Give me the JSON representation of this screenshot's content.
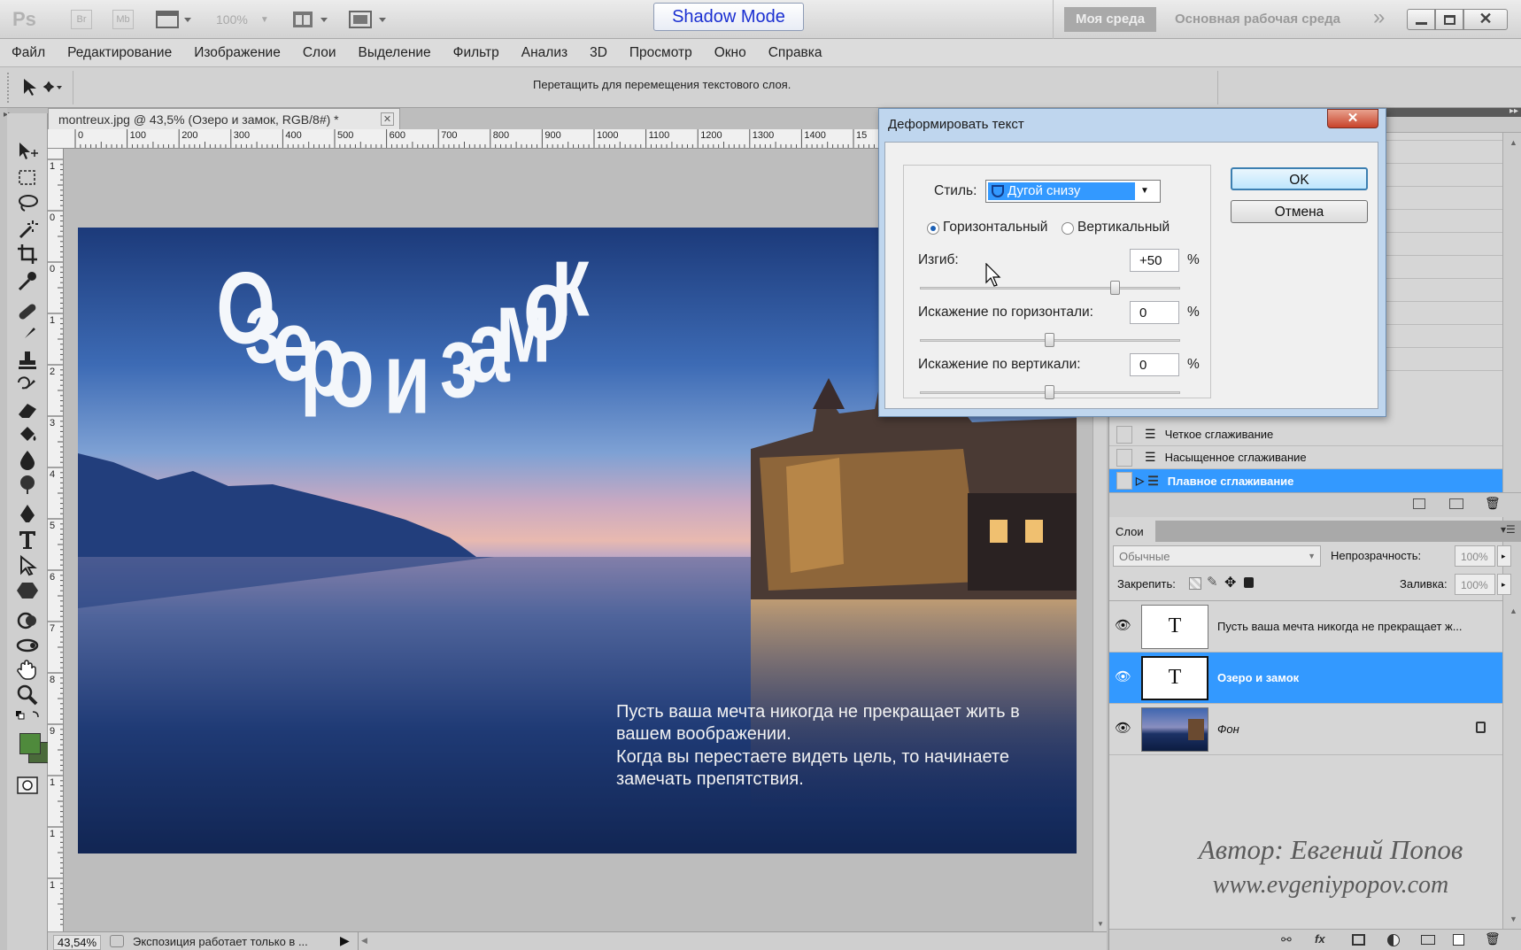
{
  "appbar": {
    "ps_logo": "Ps",
    "br_label": "Br",
    "mb_label": "Mb",
    "zoom_value": "100%",
    "shadow_mode": "Shadow Mode",
    "workspace_active": "Моя среда",
    "workspace_default": "Основная рабочая среда",
    "more_label": "»"
  },
  "menu": [
    "Файл",
    "Редактирование",
    "Изображение",
    "Слои",
    "Выделение",
    "Фильтр",
    "Анализ",
    "3D",
    "Просмотр",
    "Окно",
    "Справка"
  ],
  "options_bar": {
    "hint": "Перетащить для перемещения текстового слоя."
  },
  "document": {
    "tab_title": "montreux.jpg @ 43,5% (Озеро и замок, RGB/8#) *",
    "ruler_labels": [
      "0",
      "100",
      "200",
      "300",
      "400",
      "500",
      "600",
      "700",
      "800",
      "900",
      "1000",
      "1100",
      "1200",
      "1300",
      "1400",
      "15"
    ],
    "vruler_labels": [
      "1",
      "0",
      "0",
      "1",
      "2",
      "3",
      "4",
      "5",
      "6",
      "7",
      "8",
      "9",
      "1",
      "1",
      "1"
    ],
    "headline": "Озеро и замок",
    "body_lines": [
      "Пусть ваша мечта никогда не прекращает жить в",
      "вашем воображении.",
      "Когда вы перестаете видеть цель, то начинаете",
      "замечать препятствия."
    ]
  },
  "status": {
    "zoom": "43,54%",
    "info": "Экспозиция работает только в ..."
  },
  "dialog": {
    "title": "Деформировать текст",
    "style_label": "Стиль:",
    "style_value": "Дугой снизу",
    "orient_horizontal": "Горизонтальный",
    "orient_vertical": "Вертикальный",
    "orientation_selected": "horizontal",
    "bend_label": "Изгиб:",
    "bend_value": "+50",
    "hdist_label": "Искажение по горизонтали:",
    "hdist_value": "0",
    "vdist_label": "Искажение по вертикали:",
    "vdist_value": "0",
    "percent": "%",
    "ok": "OK",
    "cancel": "Отмена",
    "bend_fraction": 0.75,
    "hdist_fraction": 0.5,
    "vdist_fraction": 0.5
  },
  "actions_panel": {
    "items": [
      "Четкое сглаживание",
      "Насыщенное сглаживание",
      "Плавное сглаживание"
    ],
    "selected_index": 2
  },
  "layers_panel": {
    "tab": "Слои",
    "blend_mode": "Обычные",
    "opacity_label": "Непрозрачность:",
    "opacity_value": "100%",
    "lock_label": "Закрепить:",
    "fill_label": "Заливка:",
    "fill_value": "100%",
    "layers": [
      {
        "name": "Пусть ваша мечта никогда не прекращает ж...",
        "type": "text",
        "thumb": "T"
      },
      {
        "name": "Озеро и замок",
        "type": "text",
        "thumb": "T",
        "selected": true
      },
      {
        "name": "Фон",
        "type": "image",
        "locked": true
      }
    ]
  },
  "watermark": {
    "author": "Автор: Евгений Попов",
    "site": "www.evgeniypopov.com"
  },
  "colors": {
    "accent": "#3a8ee6",
    "selection": "#3399ff",
    "foreground": "#4f8a3c"
  }
}
